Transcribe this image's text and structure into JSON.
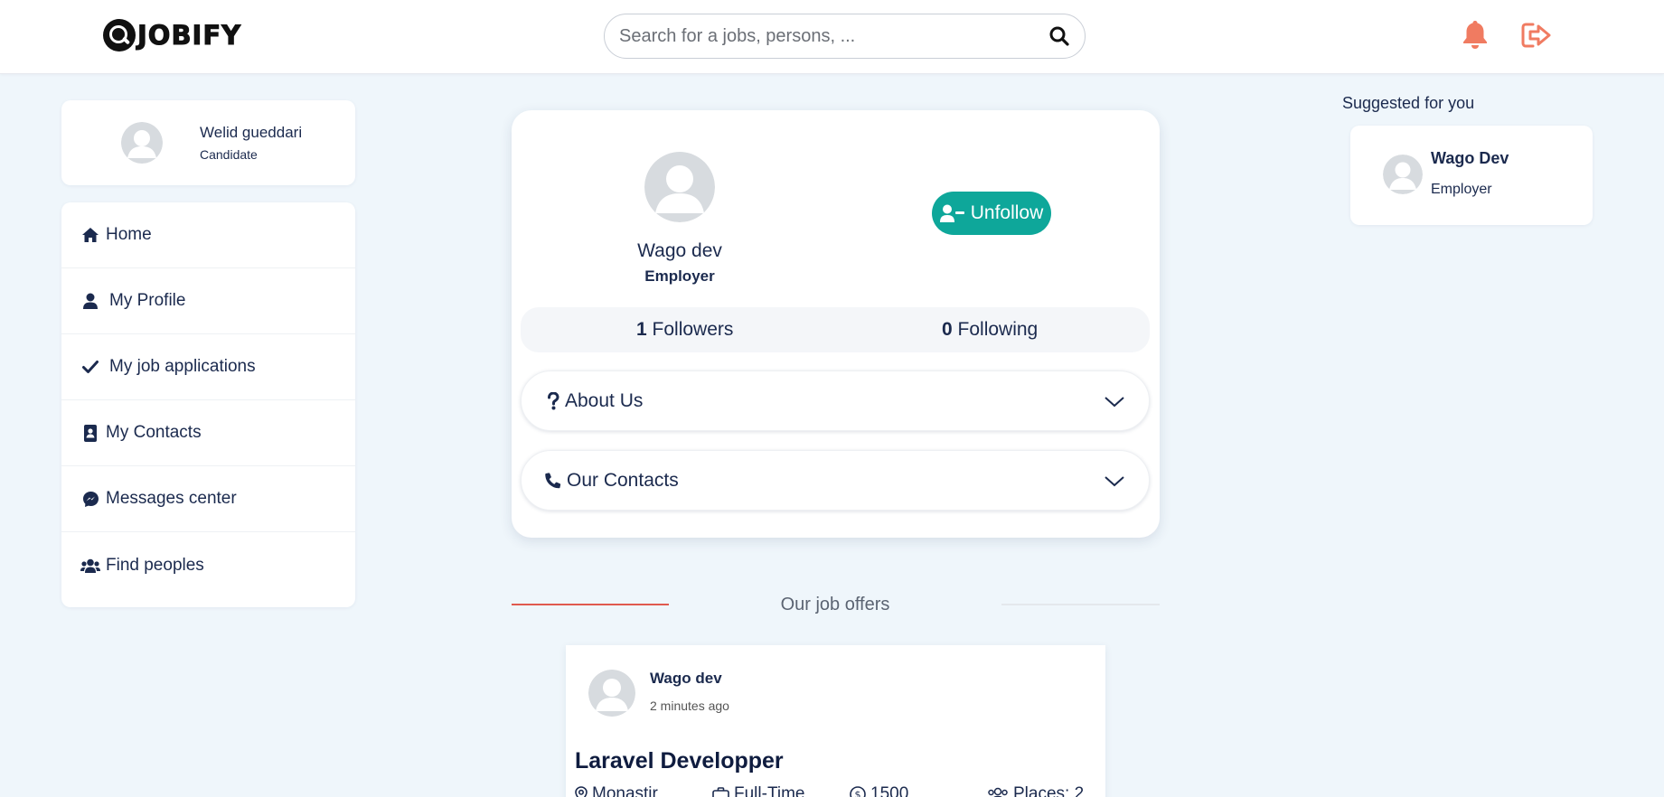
{
  "header": {
    "logo_text": "JOBIFY",
    "search_placeholder": "Search for a jobs, persons, ..."
  },
  "current_user": {
    "name": "Welid gueddari",
    "role": "Candidate"
  },
  "sidebar": {
    "items": [
      {
        "label": "Home",
        "icon": "home-icon"
      },
      {
        "label": "My Profile",
        "icon": "user-icon"
      },
      {
        "label": "My job applications",
        "icon": "check-icon"
      },
      {
        "label": "My Contacts",
        "icon": "address-book-icon"
      },
      {
        "label": "Messages center",
        "icon": "messenger-icon"
      },
      {
        "label": "Find peoples",
        "icon": "users-icon"
      }
    ]
  },
  "profile": {
    "name": "Wago dev",
    "role": "Employer",
    "unfollow_label": "Unfollow",
    "followers_count": "1",
    "followers_label": "Followers",
    "following_count": "0",
    "following_label": "Following",
    "sections": [
      {
        "label": "About Us",
        "icon": "question-icon"
      },
      {
        "label": "Our Contacts",
        "icon": "phone-icon"
      }
    ]
  },
  "job_offers": {
    "title": "Our job offers",
    "offers": [
      {
        "author": "Wago dev",
        "time": "2 minutes ago",
        "title": "Laravel Developper",
        "location": "Monastir",
        "type": "Full-Time",
        "salary": "1500",
        "places": "Places: 2"
      }
    ]
  },
  "suggested": {
    "title": "Suggested for you",
    "items": [
      {
        "name": "Wago Dev",
        "role": "Employer"
      }
    ]
  },
  "colors": {
    "accent": "#0ea79a",
    "alert": "#f07b61",
    "text": "#1b2a4e",
    "background": "#eff6fb",
    "divider_accent": "#e05a4e"
  }
}
